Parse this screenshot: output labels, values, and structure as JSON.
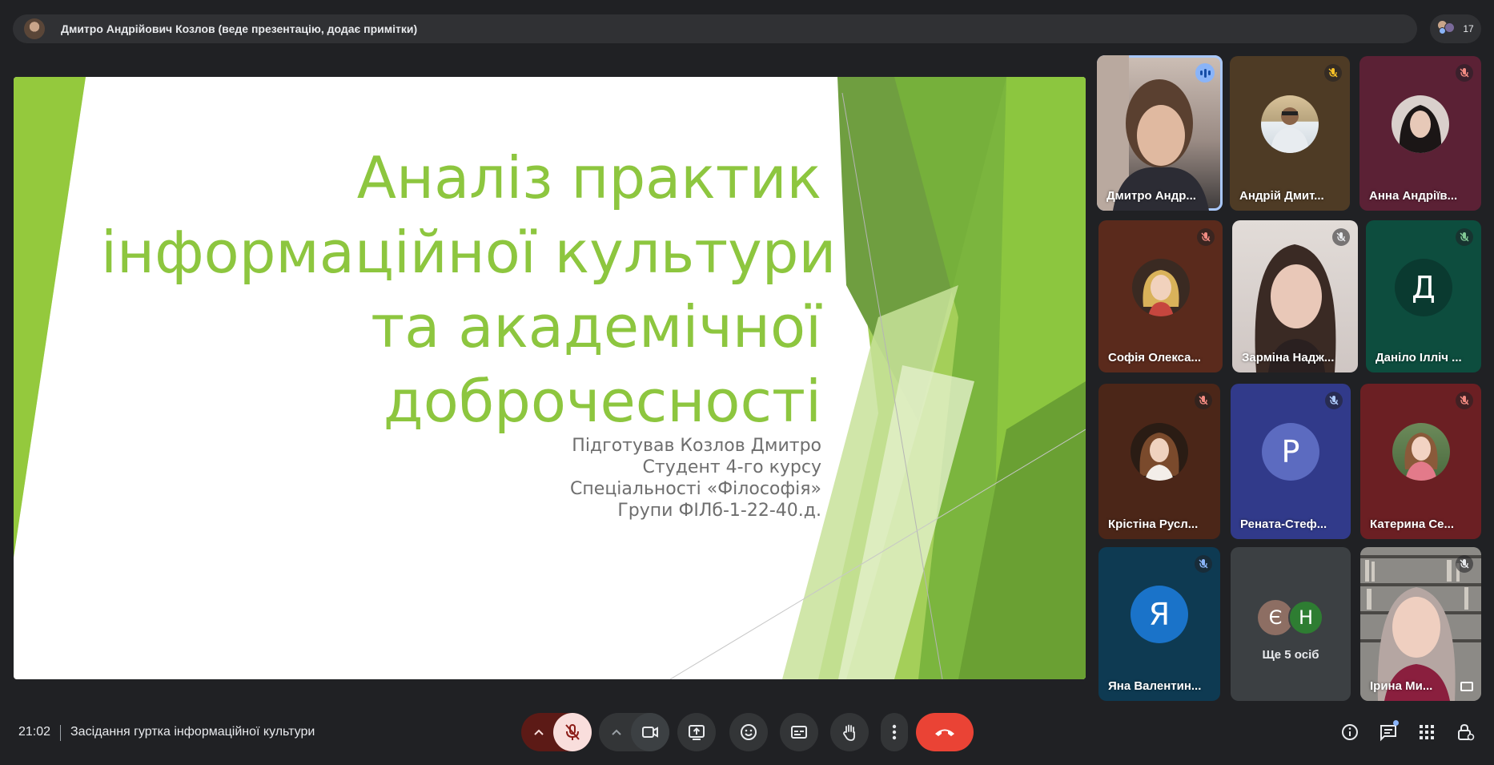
{
  "banner": {
    "presenter_text": "Дмитро Андрійович Козлов (веде презентацію, додає примітки)",
    "participant_count": "17"
  },
  "slide": {
    "title_lines": [
      "Аналіз практик",
      "інформаційної культури",
      "та академічної",
      "доброчесності"
    ],
    "subtitle_lines": [
      "Підготував Козлов Дмитро",
      "Студент 4-го курсу",
      "Спеціальності «Філософія»",
      "Групи ФІЛб-1-22-40.д."
    ],
    "accent_color": "#8dc63f"
  },
  "participants": [
    {
      "name": "Дмитро Андр...",
      "status": "speaking"
    },
    {
      "name": "Андрій Дмит...",
      "status": "muted"
    },
    {
      "name": "Анна Андріїв...",
      "status": "muted"
    },
    {
      "name": "Софія Олекса...",
      "status": "muted"
    },
    {
      "name": "Зарміна Надж...",
      "status": "muted"
    },
    {
      "name": "Даніло Ілліч ...",
      "status": "muted",
      "initial": "Д"
    },
    {
      "name": "Крістіна Русл...",
      "status": "muted"
    },
    {
      "name": "Рената-Стеф...",
      "status": "muted",
      "initial": "Р"
    },
    {
      "name": "Катерина Се...",
      "status": "muted"
    },
    {
      "name": "Яна Валентин...",
      "status": "muted",
      "initial": "Я"
    },
    {
      "name": "Ірина Ми...",
      "status": "muted"
    }
  ],
  "more_tile": {
    "initials": [
      "Є",
      "Н"
    ],
    "label": "Ще 5 осіб"
  },
  "footer": {
    "time": "21:02",
    "meeting_title": "Засідання гуртка інформаційної культури"
  },
  "controls": {
    "icons": [
      "mic-options-icon",
      "mic-off-icon",
      "camera-options-icon",
      "camera-icon",
      "present-icon",
      "emoji-icon",
      "captions-icon",
      "raise-hand-icon",
      "more-options-icon",
      "leave-call-icon",
      "info-icon",
      "chat-icon",
      "activities-icon",
      "host-controls-icon"
    ]
  }
}
